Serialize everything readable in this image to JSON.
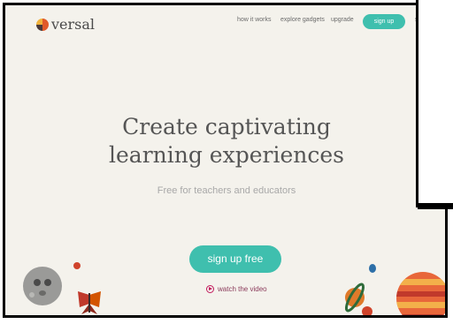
{
  "brand": {
    "name": "versal"
  },
  "nav": {
    "how_it_works": "how it works",
    "explore_gadgets": "explore gadgets",
    "upgrade": "upgrade",
    "sign_up": "sign up",
    "cut_off": "si"
  },
  "hero": {
    "headline_line1": "Create captivating",
    "headline_line2": "learning experiences",
    "subhead": "Free for teachers and educators",
    "cta": "sign up free",
    "video_link": "watch the video"
  },
  "colors": {
    "accent": "#3fbfae",
    "background": "#f4f2ec",
    "link": "#c2185b"
  },
  "icons": [
    "versal-logo-icon",
    "play-circle-icon",
    "moon-face-icon",
    "butterfly-icon",
    "planet-saturn-icon",
    "planet-striped-icon"
  ]
}
